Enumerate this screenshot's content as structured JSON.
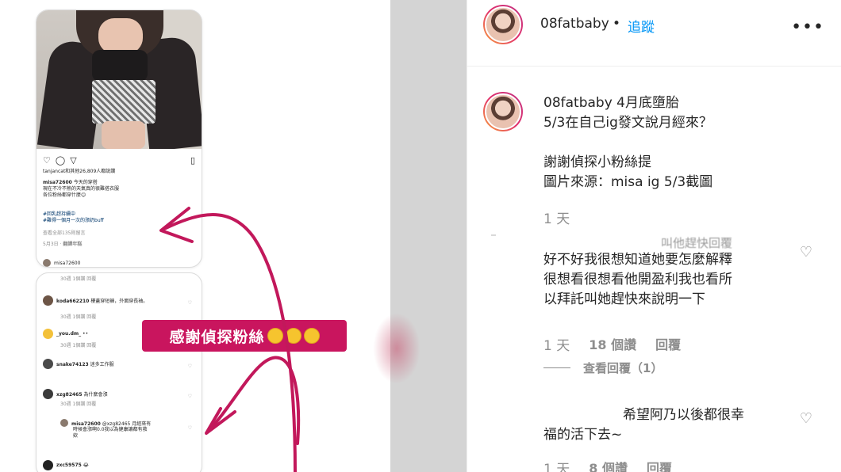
{
  "post": {
    "username": "08fatbaby",
    "separator": "•",
    "follow_label": "追蹤",
    "more_icon": "more-options-icon"
  },
  "caption": {
    "username": "08fatbaby",
    "line1_rest": "4月底墮胎",
    "line2": "5/3在自己ig發文說月經來？",
    "line3": "謝謝偵探小粉絲提",
    "line4": "圖片來源：misa ig 5/3截圖",
    "time": "1 天"
  },
  "comments": [
    {
      "line0": "叫他趕快回覆",
      "lines": [
        "好不好我很想知道她要怎麼解釋",
        "很想看很想看他開盈利我也看所",
        "以拜託叫她趕快來說明一下"
      ],
      "time": "1 天",
      "likes": "18 個讚",
      "reply_label": "回覆",
      "view_replies": "查看回覆（1）"
    },
    {
      "lines": [
        "希望阿乃以後都很幸",
        "福的活下去~"
      ],
      "time": "1 天",
      "likes": "8 個讚",
      "reply_label": "回覆"
    }
  ],
  "screenshot": {
    "liked_by": "tanjancat和其他26,809人都說讚",
    "post_user": "misa72600",
    "post_caption1": "今天的穿搭",
    "post_caption2": "現在不冷不熱的天氣真的很難搭衣服",
    "post_caption3": "各位粉絲都穿什麼😊",
    "hashtag1": "#回乳趕持續中",
    "hashtag2": "#難得一個月一次的漲奶buff",
    "view_comments": "查看全部135則留言",
    "date": "5月3日",
    "see_translation": "翻譯年糕",
    "commenter_peek": "misa72600",
    "row_meta": "30週  1個讚  回覆",
    "c1_user": "koda662210",
    "c1_text": "樓蓋穿短褲，外面穿長袖。",
    "c2_user": "_you.dm_",
    "c3_user": "snake74123",
    "c3_text": "迷多工作服",
    "c4_user": "xzg82465",
    "c4_text": "為什麼會漲",
    "reply_user": "misa72600",
    "reply_text1": "@xzg82465 月經來有",
    "reply_text2": "時候會漲啊0.0我以為健康讓都有救",
    "reply_text3": "欸",
    "c5_user": "zxc59575"
  },
  "banner": {
    "text": "感謝偵探粉絲"
  },
  "colors": {
    "brand_link": "#0095f6",
    "banner_bg": "#c9155e",
    "arrow": "#c2185b",
    "meta_grey": "#8e8e8e"
  }
}
